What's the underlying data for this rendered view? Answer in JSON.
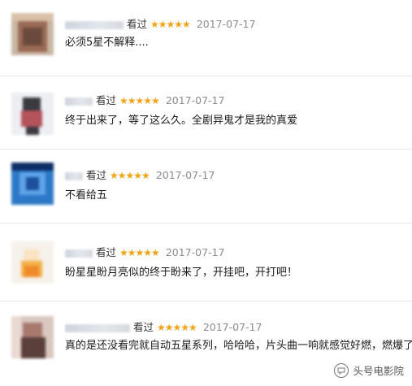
{
  "reviews": [
    {
      "watched": "看过",
      "stars": "★★★★★",
      "date": "2017-07-17",
      "comment": "必须5星不解释....",
      "avatar": {
        "bg": "#c9b7a4",
        "tones": [
          "#6b4a3d",
          "#9a6a55",
          "#d8c1a8"
        ]
      }
    },
    {
      "watched": "看过",
      "stars": "★★★★★",
      "date": "2017-07-17",
      "comment": "终于出来了，等了这么久。全剧异鬼才是我的真爱",
      "avatar": {
        "bg": "#eceef2",
        "tones": [
          "#3a3a40",
          "#b4535a",
          "#c9ccd4"
        ]
      }
    },
    {
      "watched": "看过",
      "stars": "★★★★★",
      "date": "2017-07-17",
      "comment": "不看给五",
      "avatar": {
        "bg": "#2c78c6",
        "tones": [
          "#1b4f9a",
          "#5fa3e8",
          "#0d2f66"
        ]
      }
    },
    {
      "watched": "看过",
      "stars": "★★★★★",
      "date": "2017-07-17",
      "comment": "盼星星盼月亮似的终于盼来了，开挂吧，开打吧！",
      "avatar": {
        "bg": "#f6f1ea",
        "tones": [
          "#f2b14a",
          "#f08b2a",
          "#fbe2c0"
        ]
      }
    },
    {
      "watched": "看过",
      "stars": "★★★★★",
      "date": "2017-07-17",
      "comment": "真的是还没看完就自动五星系列，哈哈哈，片头曲一响就感觉好燃，燃爆了。",
      "avatar": {
        "bg": "#d9c7c0",
        "tones": [
          "#5a3f3a",
          "#a87a6e",
          "#e9d9d2"
        ]
      }
    }
  ],
  "watermark": {
    "text": "头号电影院",
    "icon": "chat-bubble-icon"
  },
  "colors": {
    "star": "#f2a31a",
    "date": "#8c8c8c",
    "divider": "#e7e7e7"
  }
}
